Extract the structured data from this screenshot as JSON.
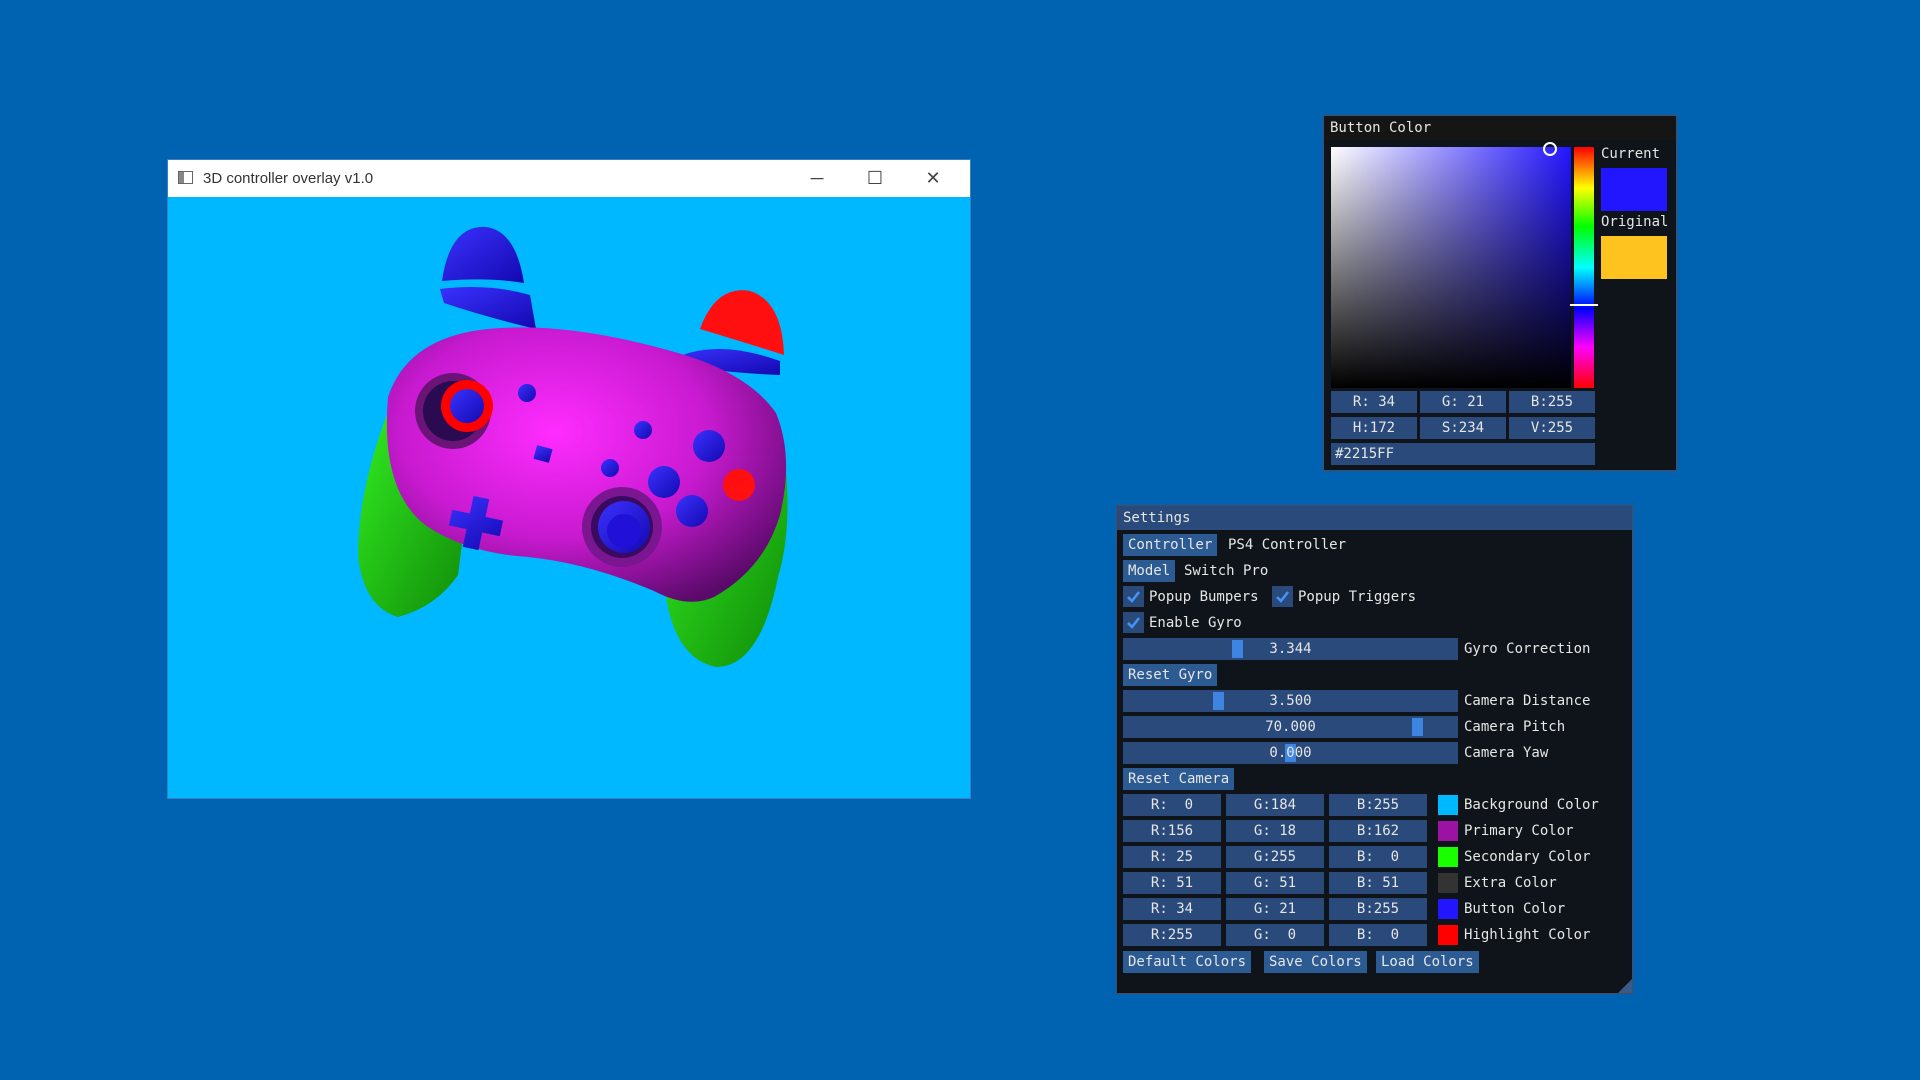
{
  "window": {
    "title": "3D controller overlay v1.0",
    "minimize_glyph": "─",
    "maximize_glyph": "☐",
    "close_glyph": "✕",
    "background_color": "#00B8FF"
  },
  "color_picker": {
    "title": "Button Color",
    "current_label": "Current",
    "original_label": "Original",
    "current_color": "#2215FF",
    "original_color": "#FFC31F",
    "rgb": [
      "R: 34",
      "G: 21",
      "B:255"
    ],
    "hsv": [
      "H:172",
      "S:234",
      "V:255"
    ],
    "hex": "#2215FF"
  },
  "settings": {
    "title": "Settings",
    "controller_button": "Controller",
    "controller_value": "PS4 Controller",
    "model_button": "Model",
    "model_value": "Switch Pro",
    "popup_bumpers": "Popup Bumpers",
    "popup_triggers": "Popup Triggers",
    "enable_gyro": "Enable Gyro",
    "gyro_correction": {
      "value": "3.344",
      "label": "Gyro Correction",
      "level": 0.34
    },
    "reset_gyro": "Reset Gyro",
    "camera_distance": {
      "value": "3.500",
      "label": "Camera Distance",
      "level": 0.28
    },
    "camera_pitch": {
      "value": "70.000",
      "label": "Camera Pitch",
      "level": 0.88
    },
    "camera_yaw": {
      "value": "0.000",
      "label": "Camera Yaw",
      "level": 0.5
    },
    "reset_camera": "Reset Camera",
    "colors": [
      {
        "r": "R:  0",
        "g": "G:184",
        "b": "B:255",
        "label": "Background Color",
        "swatch": "#00B8FF"
      },
      {
        "r": "R:156",
        "g": "G: 18",
        "b": "B:162",
        "label": "Primary Color",
        "swatch": "#9C12A2"
      },
      {
        "r": "R: 25",
        "g": "G:255",
        "b": "B:  0",
        "label": "Secondary Color",
        "swatch": "#19FF00"
      },
      {
        "r": "R: 51",
        "g": "G: 51",
        "b": "B: 51",
        "label": "Extra Color",
        "swatch": "#333333"
      },
      {
        "r": "R: 34",
        "g": "G: 21",
        "b": "B:255",
        "label": "Button Color",
        "swatch": "#2215FF"
      },
      {
        "r": "R:255",
        "g": "G:  0",
        "b": "B:  0",
        "label": "Highlight Color",
        "swatch": "#FF0000"
      }
    ],
    "default_colors": "Default Colors",
    "save_colors": "Save Colors",
    "load_colors": "Load Colors"
  }
}
